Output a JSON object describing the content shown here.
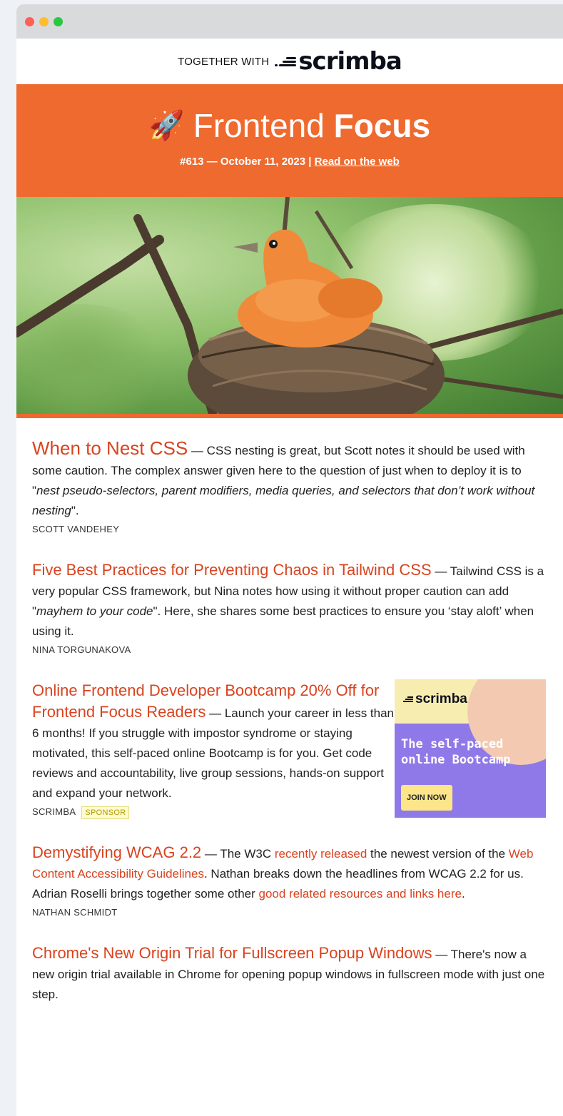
{
  "together": {
    "label": "TOGETHER WITH",
    "brand": "scrimba"
  },
  "banner": {
    "title_light": "Frontend",
    "title_bold": "Focus",
    "issue": "#613 — October 11, 2023 |",
    "read_link": "Read on the web"
  },
  "items": [
    {
      "headline": "When to Nest CSS",
      "body_a": "CSS nesting is great, but Scott notes it should be used with some caution. The complex answer given here to the question of just when to deploy it is to \"",
      "body_em": "nest pseudo-selectors, parent modifiers, media queries, and selectors that don’t work without nesting",
      "body_b": "\".",
      "source": "SCOTT VANDEHEY"
    },
    {
      "headline": "Five Best Practices for Preventing Chaos in Tailwind CSS",
      "body_a": "Tailwind CSS is a very popular CSS framework, but Nina notes how using it without proper caution can add \"",
      "body_em": "mayhem to your code",
      "body_b": "\". Here, she shares some best practices to ensure you ‘stay aloft’ when using it.",
      "source": "NINA TORGUNAKOVA"
    },
    {
      "headline": "Online Frontend Developer Bootcamp 20% Off for Frontend Focus Readers",
      "body": "Launch your career in less than 6 months! If you struggle with impostor syndrome or staying motivated, this self-paced online Bootcamp is for you. Get code reviews and accountability, live group sessions, hands-on support and expand your network.",
      "source": "SCRIMBA",
      "badge": "SPONSOR",
      "ad": {
        "brand": "scrimba",
        "text": "The self-paced online Bootcamp",
        "button": "JOIN NOW"
      }
    },
    {
      "headline": "Demystifying WCAG 2.2",
      "t1": "The W3C ",
      "l1": "recently released",
      "t2": " the newest version of the ",
      "l2": "Web Content Accessibility Guidelines",
      "t3": ". Nathan breaks down the headlines from WCAG 2.2 for us. Adrian Roselli brings together some other ",
      "l3": "good related resources and links here",
      "t4": ".",
      "source": "NATHAN SCHMIDT"
    },
    {
      "headline": "Chrome's New Origin Trial for Fullscreen Popup Windows",
      "body": "There's now a new origin trial available in Chrome for opening popup windows in fullscreen mode with just one step."
    }
  ]
}
